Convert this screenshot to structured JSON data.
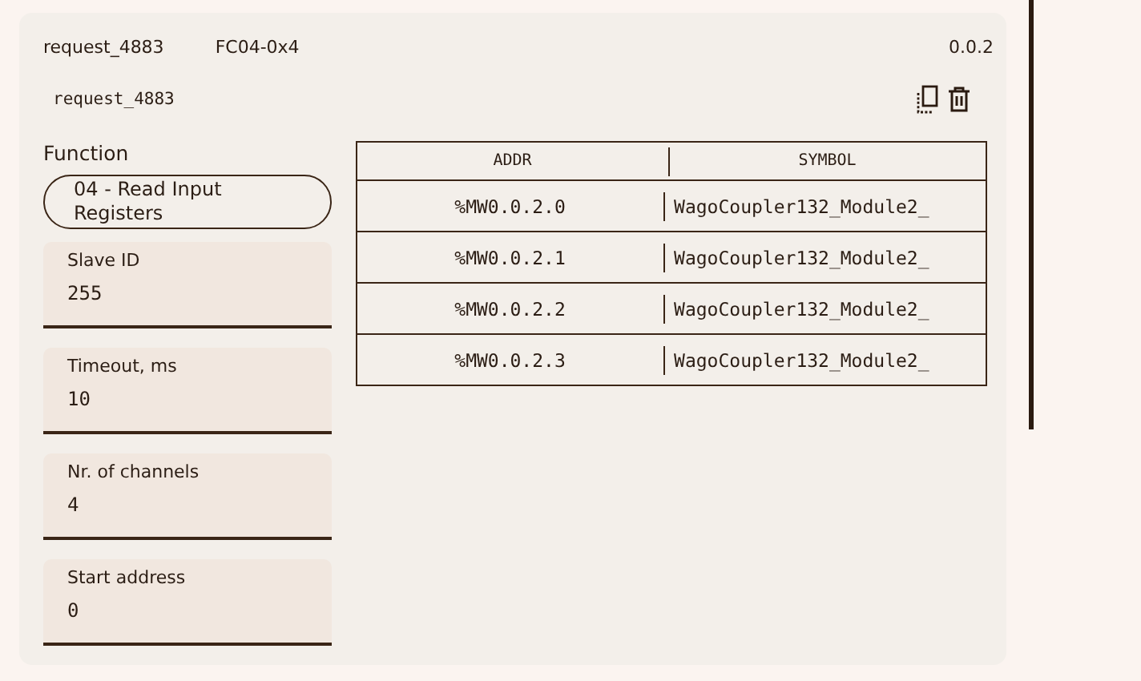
{
  "header": {
    "name": "request_4883",
    "code": "FC04-0x4",
    "version": "0.0.2"
  },
  "request_title": "request_4883",
  "function": {
    "label": "Function",
    "value": "04 - Read Input Registers"
  },
  "fields": [
    {
      "label": "Slave ID",
      "value": "255"
    },
    {
      "label": "Timeout, ms",
      "value": "10"
    },
    {
      "label": "Nr. of channels",
      "value": "4"
    },
    {
      "label": "Start address",
      "value": "0"
    }
  ],
  "table": {
    "columns": [
      "ADDR",
      "SYMBOL"
    ],
    "rows": [
      [
        "%MW0.0.2.0",
        "WagoCoupler132_Module2_"
      ],
      [
        "%MW0.0.2.1",
        "WagoCoupler132_Module2_"
      ],
      [
        "%MW0.0.2.2",
        "WagoCoupler132_Module2_"
      ],
      [
        "%MW0.0.2.3",
        "WagoCoupler132_Module2_"
      ]
    ]
  }
}
